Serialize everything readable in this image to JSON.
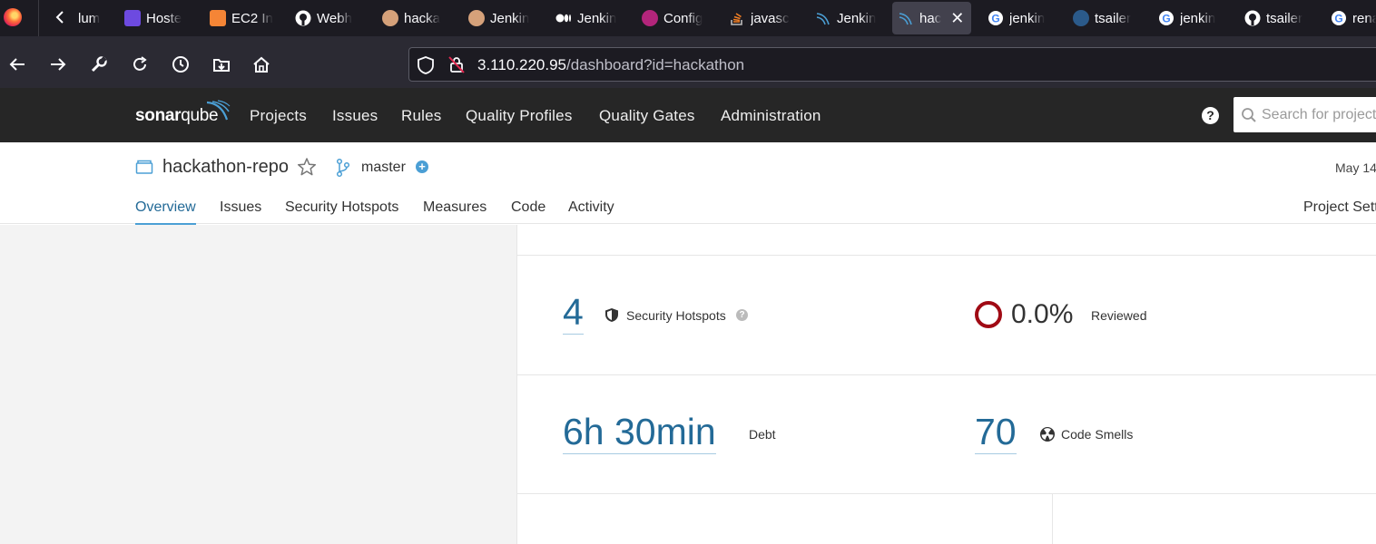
{
  "browser": {
    "tabs": [
      {
        "label": "lum",
        "favicon": "back-chevron-icon",
        "color": "#ffffff"
      },
      {
        "label": "Hoste",
        "favicon": "hosted-app-icon",
        "color": "#6d4ae0"
      },
      {
        "label": "EC2 In",
        "favicon": "aws-ec2-icon",
        "color": "#f58536"
      },
      {
        "label": "Webh",
        "favicon": "github-icon",
        "color": "#ffffff"
      },
      {
        "label": "hacka",
        "favicon": "jenkins-icon",
        "color": "#d5a17a"
      },
      {
        "label": "Jenkin",
        "favicon": "jenkins-icon",
        "color": "#d5a17a"
      },
      {
        "label": "Jenkin",
        "favicon": "medium-icon",
        "color": "#ffffff"
      },
      {
        "label": "Config",
        "favicon": "config-icon",
        "color": "#b3257b"
      },
      {
        "label": "javasc",
        "favicon": "stackoverflow-icon",
        "color": "#f48024"
      },
      {
        "label": "Jenkin",
        "favicon": "sonar-icon",
        "color": "#4b9fd5"
      },
      {
        "label": "hac",
        "favicon": "sonar-icon",
        "color": "#4b9fd5"
      },
      {
        "label": "jenkin",
        "favicon": "google-icon",
        "color": "#4285f4"
      },
      {
        "label": "tsailer",
        "favicon": "docker-icon",
        "color": "#2b5a8a"
      },
      {
        "label": "jenkin",
        "favicon": "google-icon",
        "color": "#4285f4"
      },
      {
        "label": "tsailer",
        "favicon": "github-icon",
        "color": "#ffffff"
      },
      {
        "label": "rena",
        "favicon": "google-icon",
        "color": "#4285f4"
      }
    ],
    "url_host": "3.110.220.95",
    "url_path": "/dashboard?id=hackathon"
  },
  "sonar": {
    "logo_bold": "sonar",
    "logo_light": "qube",
    "nav": [
      "Projects",
      "Issues",
      "Rules",
      "Quality Profiles",
      "Quality Gates",
      "Administration"
    ],
    "help": "?",
    "search_placeholder": "Search for projects..."
  },
  "project": {
    "name": "hackathon-repo",
    "branch": "master",
    "branch_add": "+",
    "date": "May 14",
    "tabs": [
      "Overview",
      "Issues",
      "Security Hotspots",
      "Measures",
      "Code",
      "Activity"
    ],
    "settings": "Project Settings"
  },
  "metrics": {
    "hotspots_count": "4",
    "hotspots_label": "Security Hotspots",
    "hotspots_help": "?",
    "reviewed_pct": "0.0%",
    "reviewed_label": "Reviewed",
    "debt_value": "6h 30min",
    "debt_label": "Debt",
    "smells_count": "70",
    "smells_label": "Code Smells"
  },
  "colors": {
    "accent": "#236a97",
    "link_underline": "#4b9fd5",
    "ring_red": "#a00a14",
    "header_bg": "#262626"
  }
}
